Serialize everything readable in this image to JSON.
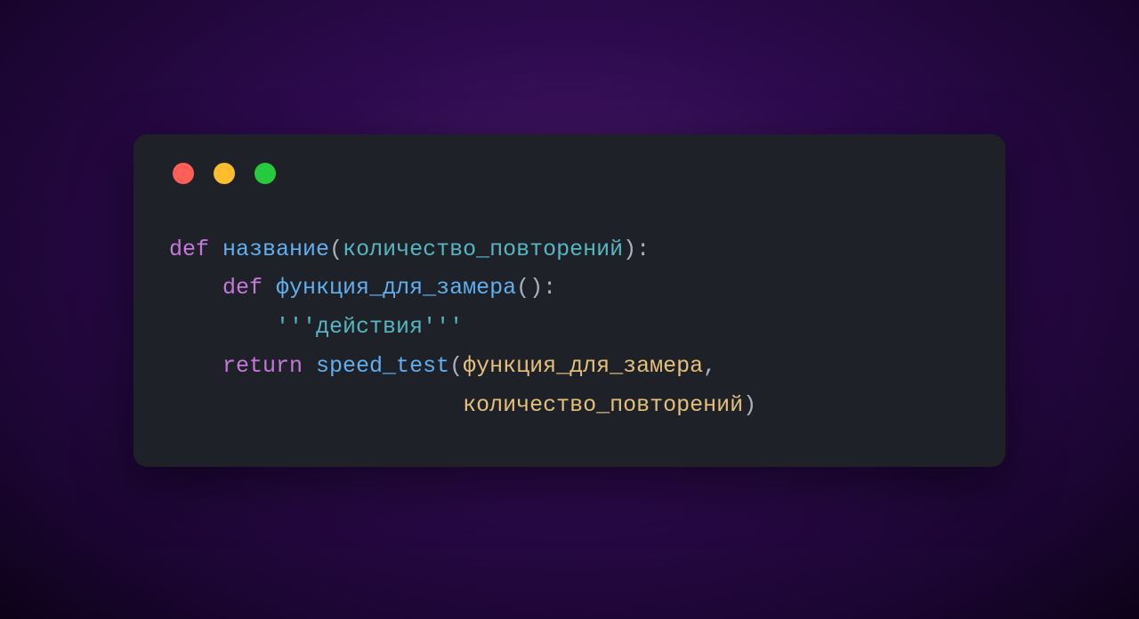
{
  "code": {
    "line1": {
      "def": "def",
      "space1": " ",
      "fname": "название",
      "lparen": "(",
      "param": "количество_повторений",
      "rparen": ")",
      "colon": ":"
    },
    "line2": {
      "indent": "    ",
      "def": "def",
      "space1": " ",
      "fname": "функция_для_замера",
      "lparen": "(",
      "rparen": ")",
      "colon": ":"
    },
    "line3": {
      "indent": "        ",
      "tq1": "'''",
      "text": "действия",
      "tq2": "'''"
    },
    "line4": {
      "indent": "    ",
      "ret": "return",
      "space1": " ",
      "call": "speed_test",
      "lparen": "(",
      "arg1": "функция_для_замера",
      "comma": ","
    },
    "line5": {
      "indent": "                      ",
      "arg2": "количество_повторений",
      "rparen": ")"
    }
  },
  "colors": {
    "keyword": "#c678dd",
    "funcname": "#61afef",
    "param": "#56b6c2",
    "string": "#56b6c2",
    "ident": "#e5c07b",
    "punct": "#abb2bf",
    "windowBg": "#1e2128"
  }
}
